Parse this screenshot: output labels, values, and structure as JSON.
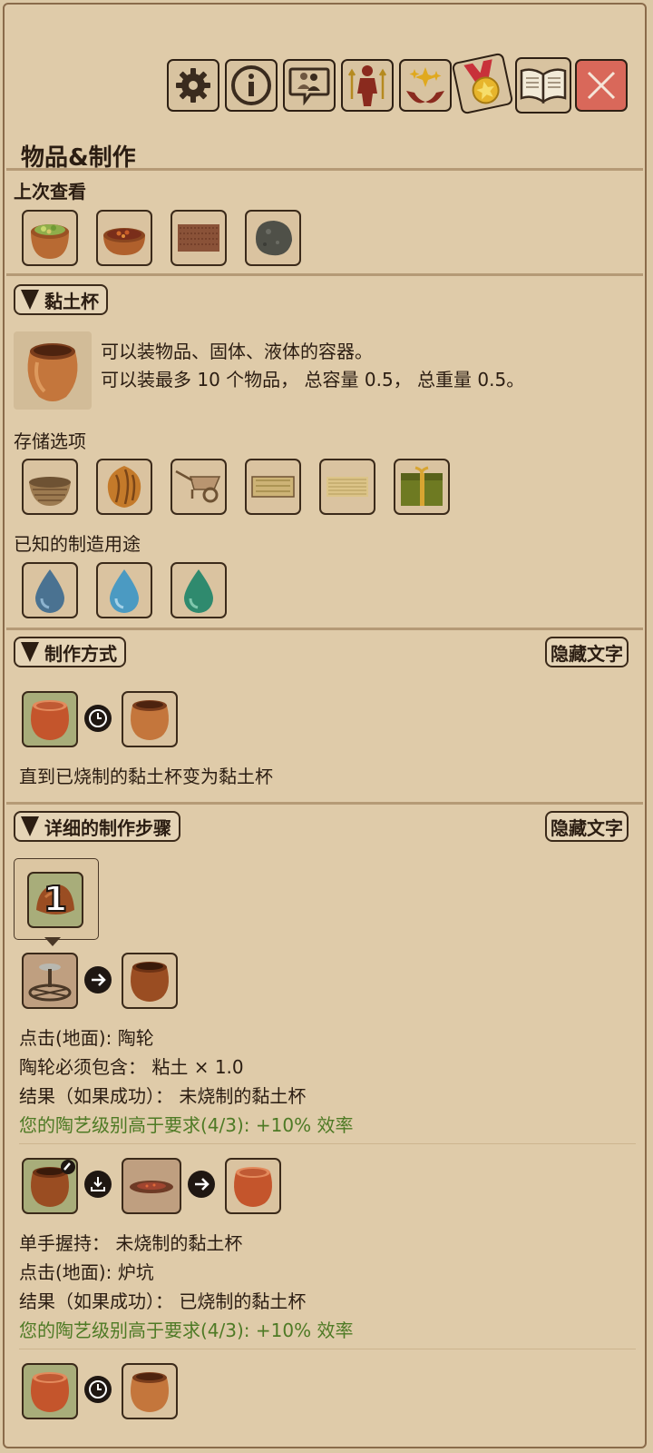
{
  "toolbar": {
    "buttons": [
      {
        "name": "settings-button",
        "icon": "gear-icon"
      },
      {
        "name": "info-button",
        "icon": "info-icon"
      },
      {
        "name": "social-button",
        "icon": "chat-people-icon"
      },
      {
        "name": "character-button",
        "icon": "character-icon"
      },
      {
        "name": "skills-button",
        "icon": "sparkle-hands-icon"
      },
      {
        "name": "achievements-button",
        "icon": "medal-icon"
      },
      {
        "name": "book-button",
        "icon": "book-icon"
      },
      {
        "name": "close-button",
        "icon": "close-icon"
      }
    ]
  },
  "page": {
    "title": "物品&制作"
  },
  "recent": {
    "label": "上次查看",
    "items": [
      "bowl-of-vegetables",
      "pot-of-beans",
      "dirt-patch",
      "stone"
    ]
  },
  "item": {
    "name": "黏土杯",
    "desc_line1": "可以装物品、固体、液体的容器。",
    "desc_line2": "可以装最多 10 个物品， 总容量 0.5， 总重量 0.5。",
    "storage_label": "存储选项",
    "storage_items": [
      "basket",
      "sack",
      "wheelbarrow",
      "mat",
      "straw-mat",
      "gift-box"
    ],
    "uses_label": "已知的制造用途",
    "uses_items": [
      "dark-water-drop",
      "water-drop",
      "green-drop"
    ]
  },
  "craft_method": {
    "header": "制作方式",
    "hide_label": "隐藏文字",
    "description": "直到已烧制的黏土杯变为黏土杯"
  },
  "steps": {
    "header": "详细的制作步骤",
    "hide_label": "隐藏文字",
    "tooltip_count": "1",
    "step1": {
      "line1": "点击(地面): 陶轮",
      "line2": "陶轮必须包含：  粘土 × 1.0",
      "line3": "结果（如果成功）：  未烧制的黏土杯",
      "line4": "您的陶艺级别高于要求(4/3): +10% 效率"
    },
    "step2": {
      "line1": "单手握持：  未烧制的黏土杯",
      "line2": "点击(地面): 炉坑",
      "line3": "结果（如果成功）：  已烧制的黏土杯",
      "line4": "您的陶艺级别高于要求(4/3): +10% 效率"
    }
  },
  "colors": {
    "background": "#dfcba9",
    "green_text": "#4e7a25",
    "close": "#d9685a"
  }
}
